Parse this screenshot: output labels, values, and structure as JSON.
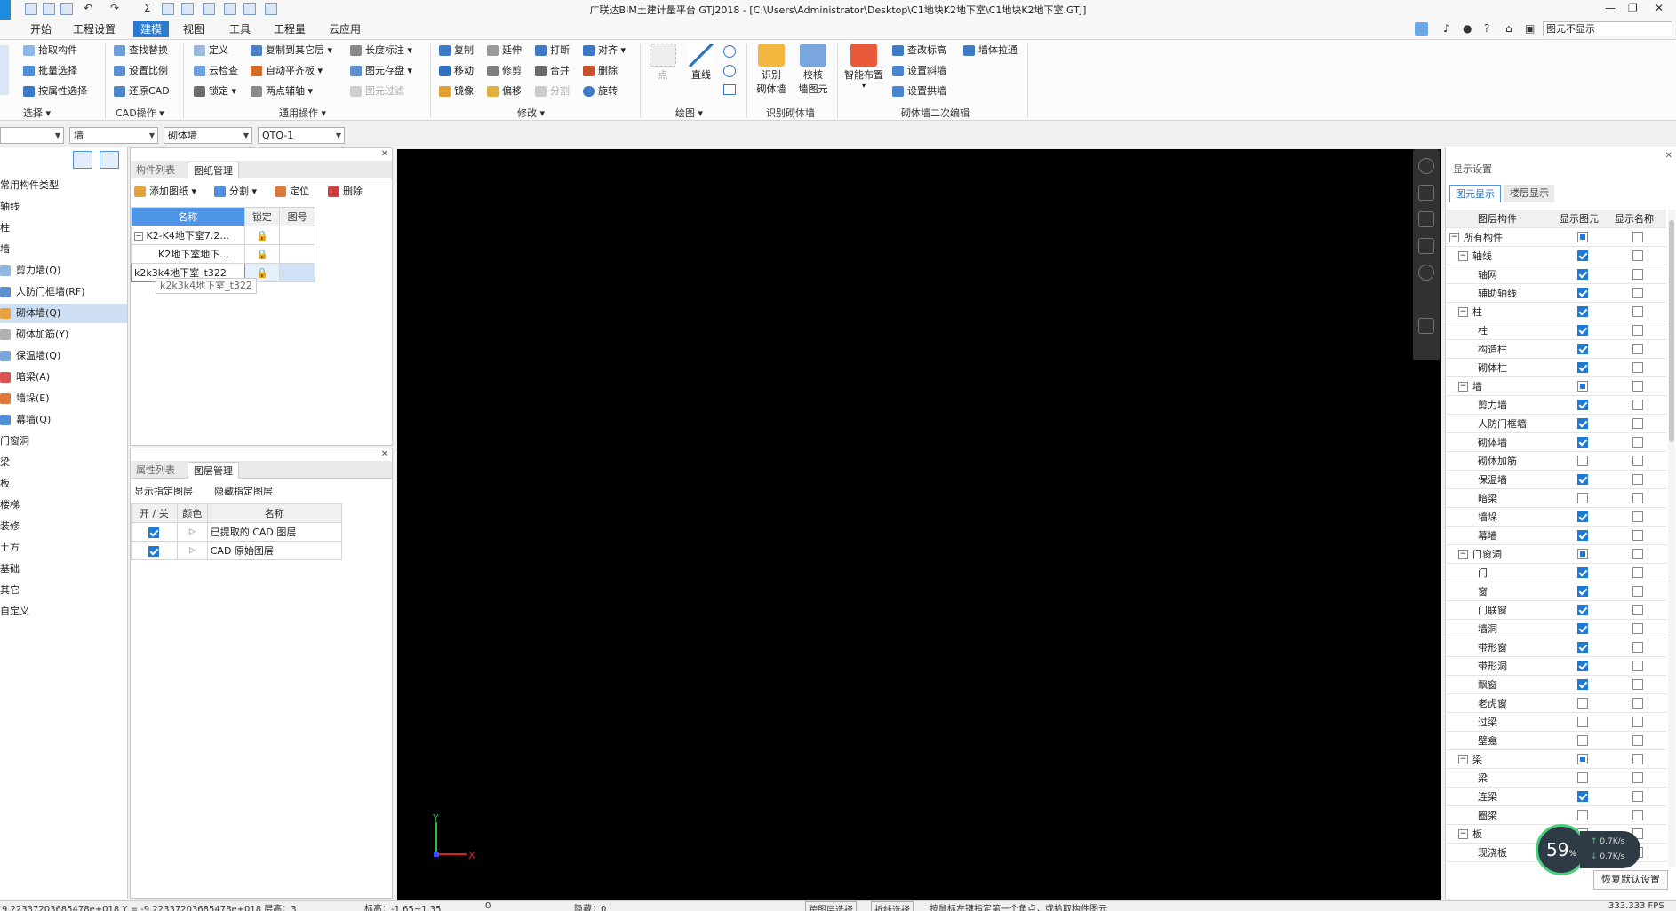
{
  "title_bar": {
    "title": "广联达BIM土建计量平台 GTJ2018 - [C:\\Users\\Administrator\\Desktop\\C1地块K2地下室\\C1地块K2地下室.GTJ]",
    "display_box": "图元不显示",
    "window_controls": [
      "—",
      "❐",
      "✕"
    ]
  },
  "ribbon_tabs": [
    "开始",
    "工程设置",
    "建模",
    "视图",
    "工具",
    "工程量",
    "云应用"
  ],
  "active_tab": "建模",
  "ribbon": {
    "select": {
      "items": [
        "拾取构件",
        "批量选择",
        "按属性选择"
      ],
      "group": "选择"
    },
    "cad": {
      "items": [
        "查找替换",
        "设置比例",
        "还原CAD"
      ],
      "group": "CAD操作"
    },
    "common_a": {
      "items": [
        "定义",
        "云检查",
        "锁定"
      ]
    },
    "common_b": {
      "items": [
        "复制到其它层",
        "自动平齐板",
        "两点辅轴"
      ]
    },
    "common_c": {
      "items": [
        "长度标注",
        "图元存盘",
        "图元过滤"
      ],
      "group": "通用操作"
    },
    "modify_a": {
      "items": [
        "复制",
        "移动",
        "镜像"
      ]
    },
    "modify_b": {
      "items": [
        "延伸",
        "修剪",
        "偏移"
      ]
    },
    "modify_c": {
      "items": [
        "打断",
        "合并",
        "分割"
      ]
    },
    "modify_d": {
      "items": [
        "对齐",
        "删除",
        "旋转"
      ],
      "group": "修改"
    },
    "draw": {
      "point": "点",
      "line": "直线",
      "group": "绘图"
    },
    "identify": {
      "btn1": "识别\n砌体墙",
      "btn2": "校核\n墙图元",
      "group": "识别砌体墙"
    },
    "secondary": {
      "smart": "智能布置",
      "items": [
        "查改标高",
        "设置斜墙",
        "设置拱墙"
      ],
      "extra": "墙体拉通",
      "group": "砌体墙二次编辑"
    }
  },
  "selectors": {
    "floor": "",
    "category": "墙",
    "type": "砌体墙",
    "instance": "QTQ-1"
  },
  "left_nav": {
    "items": [
      "常用构件类型",
      "轴线",
      "柱",
      "墙",
      "剪力墙(Q)",
      "人防门框墙(RF)",
      "砌体墙(Q)",
      "砌体加筋(Y)",
      "保温墙(Q)",
      "暗梁(A)",
      "墙垛(E)",
      "幕墙(Q)",
      "门窗洞",
      "梁",
      "板",
      "楼梯",
      "装修",
      "土方",
      "基础",
      "其它",
      "自定义"
    ],
    "selected": "砌体墙(Q)"
  },
  "drawing_panel": {
    "tabs": [
      "构件列表",
      "图纸管理"
    ],
    "active": "图纸管理",
    "toolbar": [
      "添加图纸",
      "分割",
      "定位",
      "删除"
    ],
    "columns": [
      "名称",
      "锁定",
      "图号"
    ],
    "rows": [
      {
        "name": "K2-K4地下室7.2...",
        "locked": "🔒",
        "num": ""
      },
      {
        "name": "K2地下室地下...",
        "locked": "🔒",
        "num": ""
      },
      {
        "name": "k2k3k4地下室_t322",
        "locked": "🔒",
        "num": ""
      }
    ],
    "tooltip": "k2k3k4地下室_t322"
  },
  "layer_panel": {
    "tabs": [
      "属性列表",
      "图层管理"
    ],
    "active": "图层管理",
    "toolbar": [
      "显示指定图层",
      "隐藏指定图层"
    ],
    "columns": [
      "开 / 关",
      "颜色",
      "名称"
    ],
    "rows": [
      {
        "on": true,
        "name": "已提取的 CAD 图层"
      },
      {
        "on": true,
        "name": "CAD 原始图层"
      }
    ]
  },
  "axis": {
    "y": "Y",
    "x": "X"
  },
  "display_settings": {
    "title": "显示设置",
    "tabs": [
      "图元显示",
      "楼层显示"
    ],
    "active": "图元显示",
    "columns": [
      "图层构件",
      "显示图元",
      "显示名称"
    ],
    "rows": [
      {
        "name": "所有构件",
        "level": 0,
        "exp": "−",
        "show": "part",
        "label": false
      },
      {
        "name": "轴线",
        "level": 1,
        "exp": "−",
        "show": "on",
        "label": false
      },
      {
        "name": "轴网",
        "level": 2,
        "show": "on",
        "label": false
      },
      {
        "name": "辅助轴线",
        "level": 2,
        "show": "on",
        "label": false
      },
      {
        "name": "柱",
        "level": 1,
        "exp": "−",
        "show": "on",
        "label": false
      },
      {
        "name": "柱",
        "level": 2,
        "show": "on",
        "label": false
      },
      {
        "name": "构造柱",
        "level": 2,
        "show": "on",
        "label": false
      },
      {
        "name": "砌体柱",
        "level": 2,
        "show": "on",
        "label": false
      },
      {
        "name": "墙",
        "level": 1,
        "exp": "−",
        "show": "part",
        "label": false
      },
      {
        "name": "剪力墙",
        "level": 2,
        "show": "on",
        "label": false
      },
      {
        "name": "人防门框墙",
        "level": 2,
        "show": "on",
        "label": false
      },
      {
        "name": "砌体墙",
        "level": 2,
        "show": "on",
        "label": false
      },
      {
        "name": "砌体加筋",
        "level": 2,
        "show": "off",
        "label": false
      },
      {
        "name": "保温墙",
        "level": 2,
        "show": "on",
        "label": false
      },
      {
        "name": "暗梁",
        "level": 2,
        "show": "off",
        "label": false
      },
      {
        "name": "墙垛",
        "level": 2,
        "show": "on",
        "label": false
      },
      {
        "name": "幕墙",
        "level": 2,
        "show": "on",
        "label": false
      },
      {
        "name": "门窗洞",
        "level": 1,
        "exp": "−",
        "show": "part",
        "label": false
      },
      {
        "name": "门",
        "level": 2,
        "show": "on",
        "label": false
      },
      {
        "name": "窗",
        "level": 2,
        "show": "on",
        "label": false
      },
      {
        "name": "门联窗",
        "level": 2,
        "show": "on",
        "label": false
      },
      {
        "name": "墙洞",
        "level": 2,
        "show": "on",
        "label": false
      },
      {
        "name": "带形窗",
        "level": 2,
        "show": "on",
        "label": false
      },
      {
        "name": "带形洞",
        "level": 2,
        "show": "on",
        "label": false
      },
      {
        "name": "飘窗",
        "level": 2,
        "show": "on",
        "label": false
      },
      {
        "name": "老虎窗",
        "level": 2,
        "show": "off",
        "label": false
      },
      {
        "name": "过梁",
        "level": 2,
        "show": "off",
        "label": false
      },
      {
        "name": "壁龛",
        "level": 2,
        "show": "off",
        "label": false
      },
      {
        "name": "梁",
        "level": 1,
        "exp": "−",
        "show": "part",
        "label": false
      },
      {
        "name": "梁",
        "level": 2,
        "show": "off",
        "label": false
      },
      {
        "name": "连梁",
        "level": 2,
        "show": "on",
        "label": false
      },
      {
        "name": "圈梁",
        "level": 2,
        "show": "off",
        "label": false
      },
      {
        "name": "板",
        "level": 1,
        "exp": "−",
        "show": "off",
        "label": false
      },
      {
        "name": "现浇板",
        "level": 2,
        "show": "off",
        "label": false
      }
    ],
    "restore_button": "恢复默认设置"
  },
  "speed_widget": {
    "percent": "59",
    "pct_sign": "%",
    "up": "0.7K/s",
    "down": "0.7K/s"
  },
  "status_bar": {
    "coords": "9.22337203685478e+018 Y = -9.22337203685478e+018 层高：3",
    "elev": "标高：-1.65~1.35",
    "zero": "0",
    "hidden": "隐藏：0",
    "cross_layer": "跨图层选择",
    "polyline": "折线选择",
    "hint": "按鼠标左键指定第一个角点，或拾取构件图元",
    "fps": "333.333 FPS"
  },
  "colors": {
    "accent": "#2b79d0",
    "canvas": "#000000",
    "check": "#1f7ad6"
  }
}
